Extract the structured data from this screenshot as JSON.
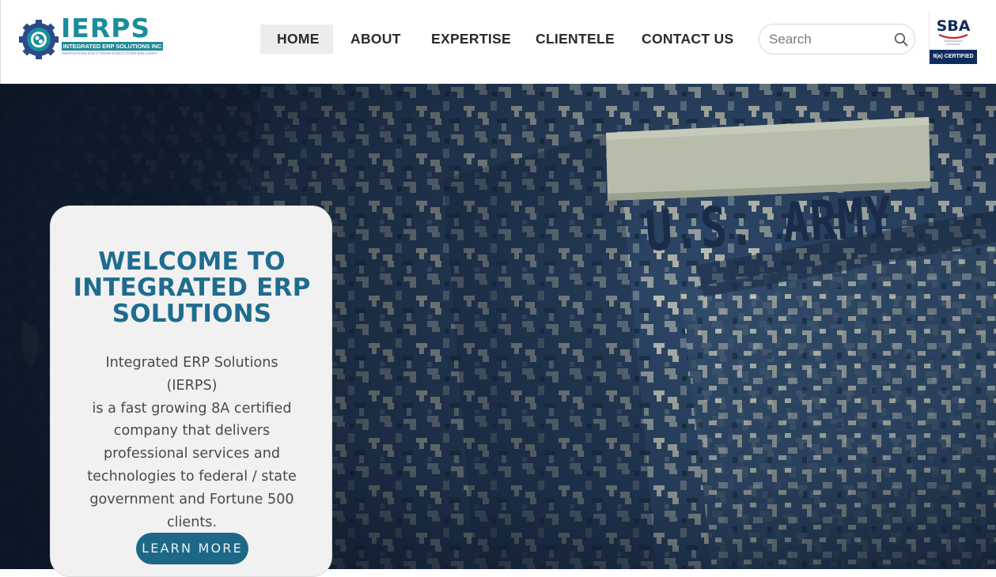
{
  "header": {
    "logo": {
      "wordmark": "IERPS",
      "full_name": "INTEGRATED ERP SOLUTIONS INC",
      "tagline": "INNOVATION-SOLUTIONS-EXECUTION-DELIVERY"
    },
    "nav": [
      {
        "label": "HOME",
        "active": true
      },
      {
        "label": "ABOUT",
        "active": false
      },
      {
        "label": "EXPERTISE",
        "active": false
      },
      {
        "label": "CLIENTELE",
        "active": false
      },
      {
        "label": "CONTACT US",
        "active": false
      }
    ],
    "search": {
      "placeholder": "Search",
      "value": "",
      "icon": "search-icon"
    },
    "certification": {
      "mark": "SBA",
      "caption": "8(a) CERTIFIED"
    }
  },
  "hero": {
    "background": "U.S. Army digital camouflage uniform photo",
    "patch_text": "U.S. ARMY",
    "card": {
      "title_lines": [
        "WELCOME TO",
        "INTEGRATED ERP",
        "SOLUTIONS"
      ],
      "body_lines": [
        "Integrated ERP Solutions (IERPS)",
        "is a fast growing 8A certified",
        "company that delivers",
        "professional services and",
        "technologies to federal / state",
        "government and Fortune 500",
        "clients."
      ],
      "button_label": "LEARN MORE"
    }
  },
  "colors": {
    "brand_teal": "#1a8d9b",
    "title_blue": "#1e6c8f",
    "button_blue": "#1d6886",
    "sba_navy": "#0e2d5c",
    "nav_active_bg": "#ececec",
    "card_bg": "#f1f1f1"
  }
}
